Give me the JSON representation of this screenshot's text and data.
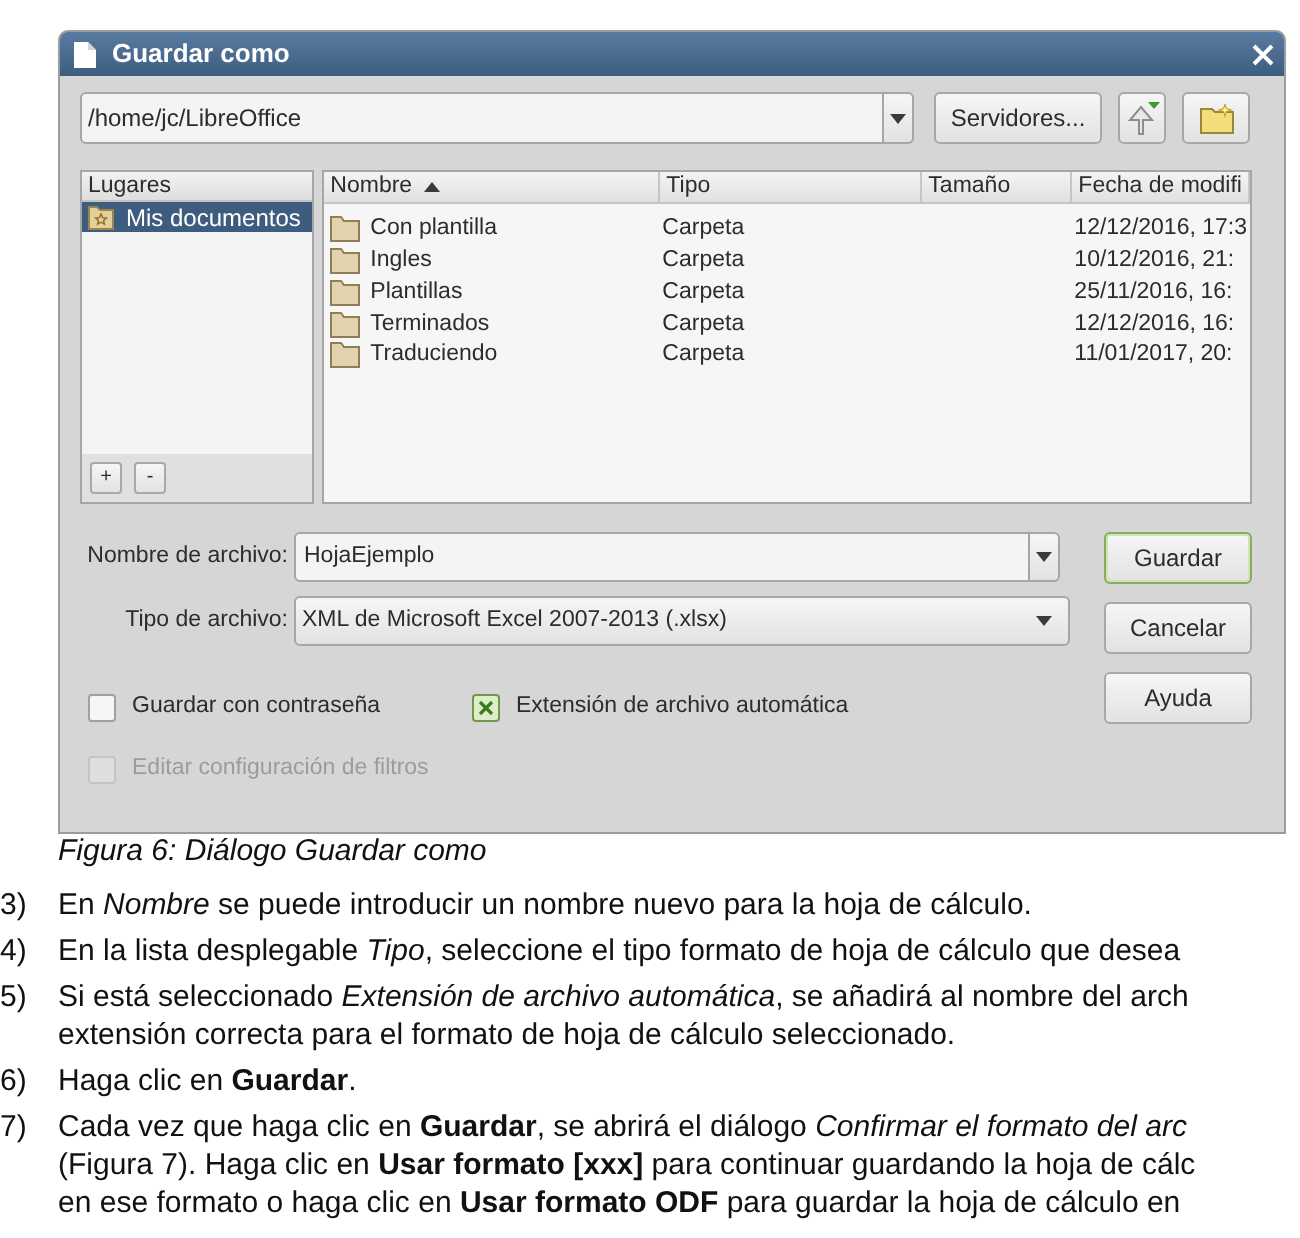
{
  "dialog": {
    "title": "Guardar como",
    "location": {
      "value": "/home/jc/LibreOffice"
    },
    "servers_button": "Servidores...",
    "places": {
      "header": "Lugares",
      "items": [
        {
          "label": "Mis documentos",
          "selected": true
        }
      ],
      "buttons": [
        "+",
        "-"
      ]
    },
    "files": {
      "columns": [
        {
          "label": "Nombre",
          "sorted": true
        },
        {
          "label": "Tipo",
          "sorted": false
        },
        {
          "label": "Tamaño",
          "sorted": false
        },
        {
          "label": "Fecha de modifi",
          "sorted": false
        }
      ],
      "rows": [
        {
          "name": "Con plantilla",
          "type": "Carpeta",
          "modified": "12/12/2016, 17:3"
        },
        {
          "name": "Ingles",
          "type": "Carpeta",
          "modified": "10/12/2016, 21:"
        },
        {
          "name": "Plantillas",
          "type": "Carpeta",
          "modified": "25/11/2016, 16:"
        },
        {
          "name": "Terminados",
          "type": "Carpeta",
          "modified": "12/12/2016, 16:"
        },
        {
          "name": "Traduciendo",
          "type": "Carpeta",
          "modified": "11/01/2017, 20:"
        }
      ]
    },
    "fields": [
      {
        "kind": "combo",
        "label": "Nombre de archivo:",
        "value": "HojaEjemplo"
      },
      {
        "kind": "select",
        "label": "Tipo de archivo:",
        "value": "XML de Microsoft Excel 2007-2013 (.xlsx)"
      }
    ],
    "options": [
      {
        "label": "Guardar con contraseña",
        "checked": false,
        "disabled": false
      },
      {
        "label": "Extensión de archivo automática",
        "checked": true,
        "disabled": false
      },
      {
        "label": "Editar configuración de filtros",
        "checked": false,
        "disabled": true
      }
    ],
    "buttons": [
      {
        "label": "Guardar",
        "default": true
      },
      {
        "label": "Cancelar",
        "default": false
      },
      {
        "label": "Ayuda",
        "default": false
      }
    ]
  },
  "caption": "Figura 6: Diálogo Guardar como",
  "steps": [
    {
      "number": "3)",
      "lines": [
        "En *Nombre* se puede introducir un nombre nuevo para la hoja de cálculo."
      ]
    },
    {
      "number": "4)",
      "lines": [
        "En la lista desplegable *Tipo*, seleccione el tipo formato de hoja de cálculo que desea"
      ]
    },
    {
      "number": "5)",
      "lines": [
        "Si está seleccionado *Extensión de archivo automática*, se añadirá al nombre del arch",
        "extensión correcta para el formato de hoja de cálculo seleccionado."
      ]
    },
    {
      "number": "6)",
      "lines": [
        "Haga clic en **Guardar**."
      ]
    },
    {
      "number": "7)",
      "lines": [
        "Cada vez que haga clic en **Guardar**, se abrirá el diálogo *Confirmar el formato del arc*",
        "(Figura 7). Haga clic en **Usar formato [xxx]** para continuar guardando la hoja de cálc",
        "en ese formato o haga clic en **Usar formato ODF** para guardar la hoja de cálculo en"
      ]
    }
  ]
}
